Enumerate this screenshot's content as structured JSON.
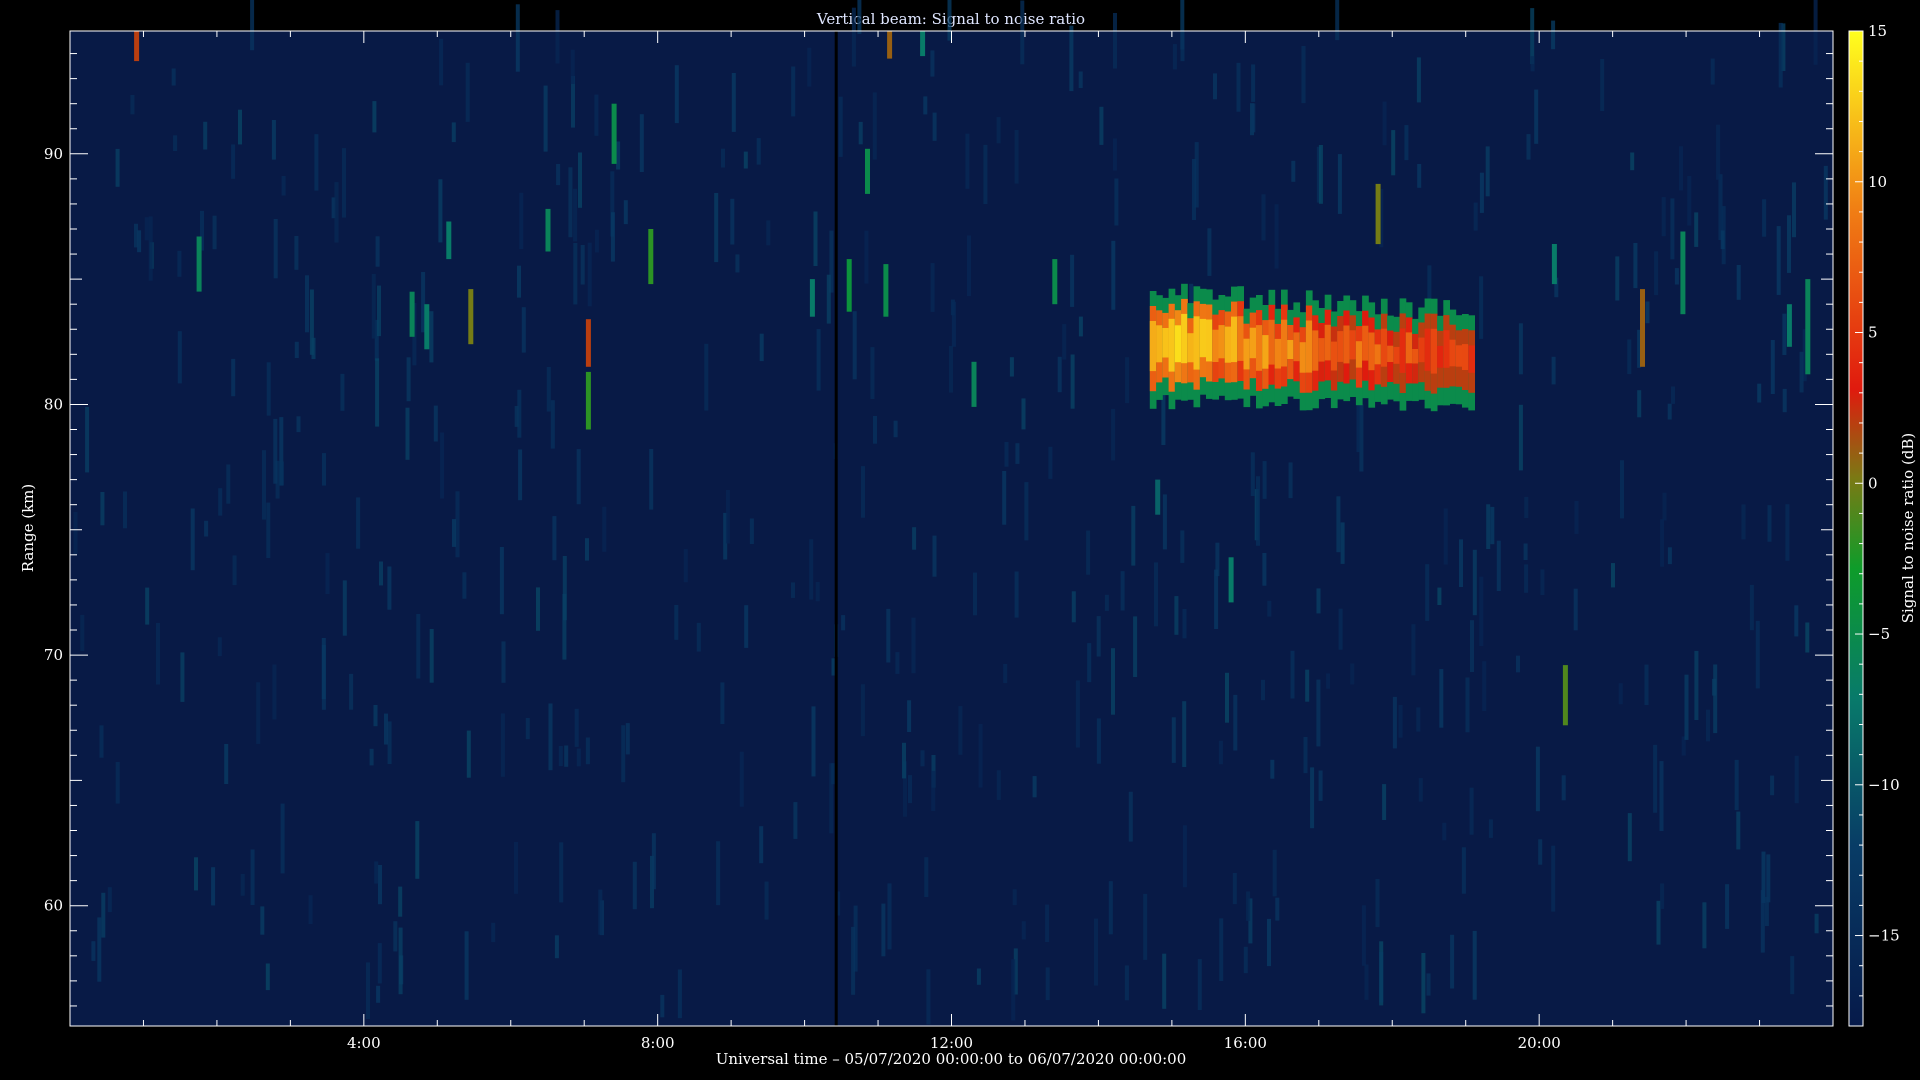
{
  "chart_data": {
    "type": "heatmap",
    "title": "Vertical beam: Signal to noise ratio",
    "xlabel": "Universal time – 05/07/2020 00:00:00 to 06/07/2020 00:00:00",
    "ylabel": "Range (km)",
    "colorbar_label": "Signal to noise ratio (dB)",
    "xlim_hours": [
      0,
      24
    ],
    "ylim_km": [
      55.2,
      94.9
    ],
    "x_ticks": [
      {
        "value": 4,
        "label": "4:00"
      },
      {
        "value": 8,
        "label": "8:00"
      },
      {
        "value": 12,
        "label": "12:00"
      },
      {
        "value": 16,
        "label": "16:00"
      },
      {
        "value": 20,
        "label": "20:00"
      }
    ],
    "y_ticks": [
      {
        "value": 60,
        "label": "60"
      },
      {
        "value": 70,
        "label": "70"
      },
      {
        "value": 80,
        "label": "80"
      },
      {
        "value": 90,
        "label": "90"
      }
    ],
    "colorbar_range_db": [
      -18,
      15
    ],
    "colorbar_ticks": [
      {
        "value": -15,
        "label": "−15"
      },
      {
        "value": -10,
        "label": "−10"
      },
      {
        "value": -5,
        "label": "−5"
      },
      {
        "value": 0,
        "label": "0"
      },
      {
        "value": 5,
        "label": "5"
      },
      {
        "value": 10,
        "label": "10"
      },
      {
        "value": 15,
        "label": "15"
      }
    ],
    "background_level_db": -16,
    "data_gap_hour": 10.43,
    "echo_region": {
      "t_start": 14.7,
      "t_end": 19.1,
      "range_bottom_km": 80,
      "range_top_km": 84.5,
      "peak_db": 13
    },
    "echo_spots": [
      {
        "t": 0.9,
        "r0": 93.7,
        "r1": 94.9,
        "db": 2
      },
      {
        "t": 1.75,
        "r0": 84.5,
        "r1": 86.7,
        "db": -6
      },
      {
        "t": 4.65,
        "r0": 82.7,
        "r1": 84.5,
        "db": -6
      },
      {
        "t": 4.85,
        "r0": 82.2,
        "r1": 84.0,
        "db": -7
      },
      {
        "t": 5.15,
        "r0": 85.8,
        "r1": 87.3,
        "db": -7
      },
      {
        "t": 5.45,
        "r0": 82.4,
        "r1": 84.6,
        "db": 0
      },
      {
        "t": 6.5,
        "r0": 86.1,
        "r1": 87.8,
        "db": -6
      },
      {
        "t": 7.05,
        "r0": 79.0,
        "r1": 81.3,
        "db": -2
      },
      {
        "t": 7.05,
        "r0": 81.5,
        "r1": 83.4,
        "db": 2
      },
      {
        "t": 7.4,
        "r0": 89.6,
        "r1": 92.0,
        "db": -5
      },
      {
        "t": 7.9,
        "r0": 84.8,
        "r1": 87.0,
        "db": -2
      },
      {
        "t": 10.1,
        "r0": 83.5,
        "r1": 85.0,
        "db": -7
      },
      {
        "t": 10.6,
        "r0": 83.7,
        "r1": 85.8,
        "db": -4
      },
      {
        "t": 10.85,
        "r0": 88.4,
        "r1": 90.2,
        "db": -5
      },
      {
        "t": 11.1,
        "r0": 83.5,
        "r1": 85.6,
        "db": -5
      },
      {
        "t": 11.15,
        "r0": 93.8,
        "r1": 94.9,
        "db": 1
      },
      {
        "t": 11.6,
        "r0": 93.9,
        "r1": 94.9,
        "db": -7
      },
      {
        "t": 12.3,
        "r0": 79.9,
        "r1": 81.7,
        "db": -6
      },
      {
        "t": 13.4,
        "r0": 84.0,
        "r1": 85.8,
        "db": -5
      },
      {
        "t": 14.8,
        "r0": 75.6,
        "r1": 77.0,
        "db": -9
      },
      {
        "t": 15.8,
        "r0": 72.1,
        "r1": 73.9,
        "db": -7
      },
      {
        "t": 17.8,
        "r0": 86.4,
        "r1": 88.8,
        "db": 0
      },
      {
        "t": 20.2,
        "r0": 84.8,
        "r1": 86.4,
        "db": -7
      },
      {
        "t": 20.35,
        "r0": 67.2,
        "r1": 69.6,
        "db": -1
      },
      {
        "t": 21.4,
        "r0": 81.5,
        "r1": 84.6,
        "db": 1
      },
      {
        "t": 21.95,
        "r0": 83.6,
        "r1": 86.9,
        "db": -6
      },
      {
        "t": 23.4,
        "r0": 82.3,
        "r1": 84.0,
        "db": -7
      },
      {
        "t": 23.65,
        "r0": 81.2,
        "r1": 85.0,
        "db": -6
      }
    ]
  }
}
